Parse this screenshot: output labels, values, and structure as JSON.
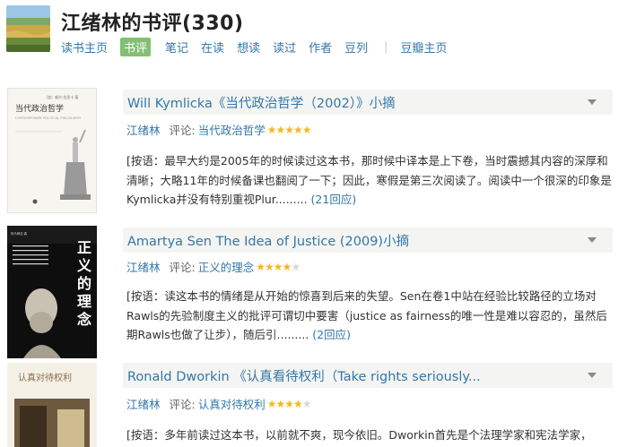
{
  "header": {
    "title": "江绪林的书评(330)",
    "nav": [
      {
        "label": "读书主页",
        "active": false
      },
      {
        "label": "书评",
        "active": true
      },
      {
        "label": "笔记",
        "active": false
      },
      {
        "label": "在读",
        "active": false
      },
      {
        "label": "想读",
        "active": false
      },
      {
        "label": "读过",
        "active": false
      },
      {
        "label": "作者",
        "active": false
      },
      {
        "label": "豆列",
        "active": false
      }
    ],
    "separator": "|",
    "nav_extra": "豆瓣主页"
  },
  "reviews": [
    {
      "title": "Will Kymlicka《当代政治哲学（2002）》小摘",
      "author": "江绪林",
      "review_label": "评论:",
      "book": "当代政治哲学",
      "rating": 5,
      "excerpt": "[按语：最早大约是2005年的时候读过这本书，那时候中译本是上下卷，当时震撼其内容的深厚和清晰；大略11年的时候备课也翻阅了一下；因此，寒假是第三次阅读了。阅读中一个很深的印象是Kymlicka并没有特别重视Plur.........",
      "replies": "(21回应)",
      "cover": {
        "title": "当代政治哲学",
        "author_line": "〔加〕威尔·金里卡 著",
        "subtitle": "CONTEMPORARY POLITICAL PHILOSOPHY"
      }
    },
    {
      "title": "Amartya Sen The Idea of Justice (2009)小摘",
      "author": "江绪林",
      "review_label": "评论:",
      "book": "正义的理念",
      "rating": 4,
      "excerpt": "[按语：读这本书的情绪是从开始的惊喜到后来的失望。Sen在卷1中站在经验比较路径的立场对Rawls的先验制度主义的批评可谓切中要害（justice as fairness的唯一性是难以容忍的，虽然后期Rawls也做了让步），随后引.........",
      "replies": "(2回应)",
      "cover": {
        "title": "正义的理念",
        "author_line": "阿马蒂亚·森"
      }
    },
    {
      "title": "Ronald Dworkin 《认真看待权利（Take rights seriously...",
      "author": "江绪林",
      "review_label": "评论:",
      "book": "认真对待权利",
      "rating": 4,
      "excerpt": "[按语：多年前读过这本书，以前就不爽，现今依旧。Dworkin首先是个法理学家和宪法学家，",
      "replies": "",
      "cover": {
        "title": "认真对待权利"
      }
    }
  ],
  "colors": {
    "link": "#3377aa",
    "active_tab": "#83bf73",
    "title_bar": "#f4f5f2",
    "star_on": "#f5b81b",
    "star_off": "#d7d7d7"
  }
}
